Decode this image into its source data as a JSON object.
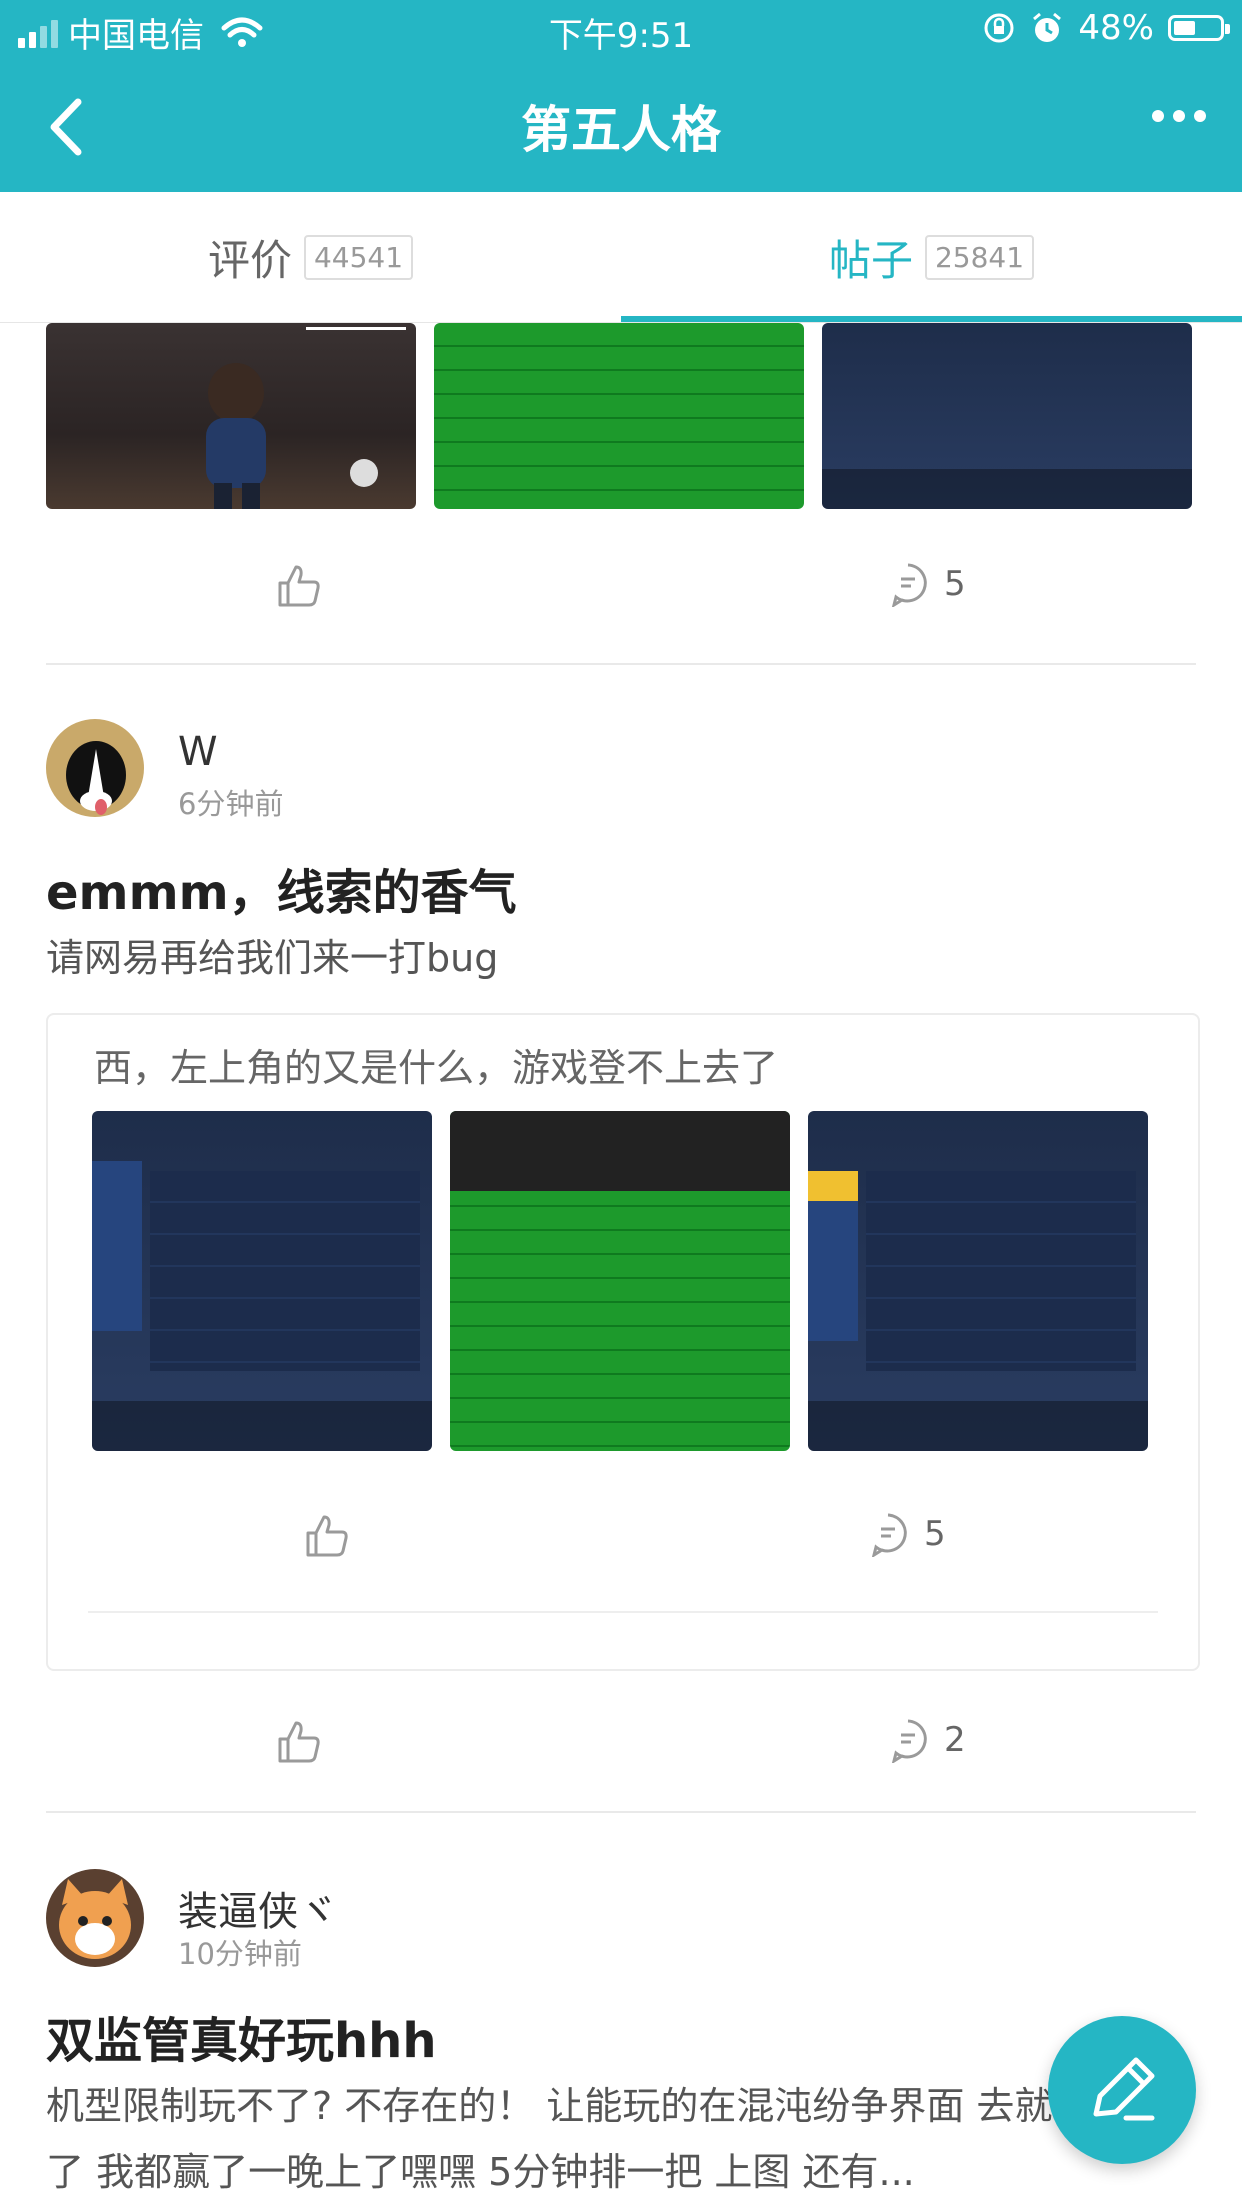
{
  "status_bar": {
    "carrier": "中国电信",
    "time": "下午9:51",
    "battery": "48%",
    "battery_level": 0.48
  },
  "nav": {
    "title": "第五人格"
  },
  "tabs": [
    {
      "label": "评价",
      "count": "44541",
      "active": false
    },
    {
      "label": "帖子",
      "count": "25841",
      "active": true
    }
  ],
  "post_prev": {
    "comments": "5"
  },
  "post1": {
    "user": "W",
    "time": "6分钟前",
    "title": "emmm，线索的香气",
    "body": "请网易再给我们来一打bug",
    "quote": {
      "text": "西，左上角的又是什么，游戏登不上去了",
      "comments": "5"
    },
    "comments": "2"
  },
  "post2": {
    "user": "装逼侠ヾ",
    "time": "10分钟前",
    "title": "双监管真好玩hhh",
    "body": "机型限制玩不了? 不存在的！ 让能玩的在混沌纷争界面 去就能玩了 我都赢了一晚上了嘿嘿 5分钟排一把 上图 还有..."
  },
  "colors": {
    "accent": "#25b6c4",
    "icon_gray": "#9a9a9a"
  },
  "icons": [
    "back-arrow-icon",
    "more-icon",
    "wifi-icon",
    "lock-rotation-icon",
    "alarm-icon",
    "thumbs-up-icon",
    "comment-icon",
    "edit-pencil-icon"
  ]
}
